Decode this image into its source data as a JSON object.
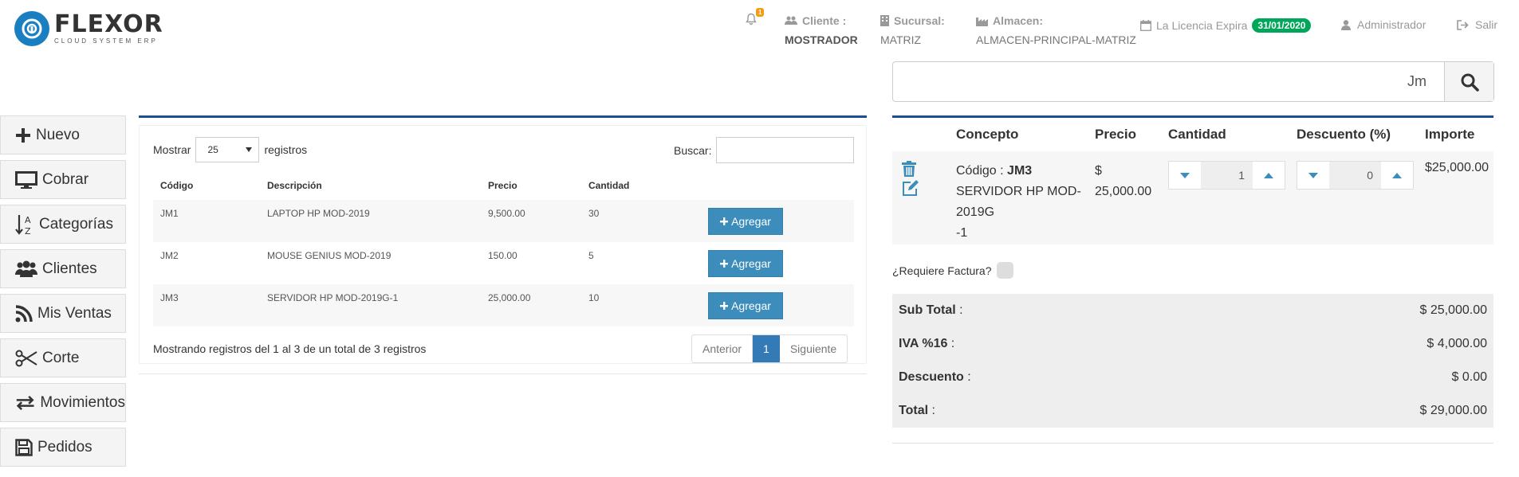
{
  "header": {
    "logo_name": "FLEXOR",
    "logo_tagline": "CLOUD SYSTEM ERP",
    "notification_count": "1",
    "cliente_label": "Cliente :",
    "cliente_value": "MOSTRADOR",
    "sucursal_label": "Sucursal:",
    "sucursal_value": "MATRIZ",
    "almacen_label": "Almacen:",
    "almacen_value": "ALMACEN-PRINCIPAL-MATRIZ",
    "license_label": "La Licencia Expira",
    "license_date": "31/01/2020",
    "user_label": "Administrador",
    "logout_label": "Salir"
  },
  "sidebar": {
    "items": [
      {
        "label": "Nuevo",
        "icon": "plus-icon"
      },
      {
        "label": "Cobrar",
        "icon": "monitor-icon"
      },
      {
        "label": "Categorías",
        "icon": "sort-alpha-icon"
      },
      {
        "label": "Clientes",
        "icon": "users-icon"
      },
      {
        "label": "Mis Ventas",
        "icon": "rss-icon"
      },
      {
        "label": "Corte",
        "icon": "scissors-icon"
      },
      {
        "label": "Movimientos",
        "icon": "exchange-icon"
      },
      {
        "label": "Pedidos",
        "icon": "save-icon"
      }
    ]
  },
  "products": {
    "show_label": "Mostrar",
    "show_value": "25",
    "records_label": "registros",
    "search_label": "Buscar:",
    "columns": [
      "Código",
      "Descripción",
      "Precio",
      "Cantidad"
    ],
    "rows": [
      {
        "code": "JM1",
        "desc": "LAPTOP HP MOD-2019",
        "price": "9,500.00",
        "qty": "30",
        "action": "Agregar"
      },
      {
        "code": "JM2",
        "desc": "MOUSE GENIUS MOD-2019",
        "price": "150.00",
        "qty": "5",
        "action": "Agregar"
      },
      {
        "code": "JM3",
        "desc": "SERVIDOR HP MOD-2019G-1",
        "price": "25,000.00",
        "qty": "10",
        "action": "Agregar"
      }
    ],
    "showing_text": "Mostrando registros del 1 al 3 de un total de 3 registros",
    "pager": {
      "prev": "Anterior",
      "current": "1",
      "next": "Siguiente"
    }
  },
  "search": {
    "value": "Jm"
  },
  "cart": {
    "columns": [
      "Concepto",
      "Precio",
      "Cantidad",
      "Descuento (%)",
      "Importe"
    ],
    "item": {
      "code_label": "Código :",
      "code": "JM3",
      "desc_line1": "SERVIDOR HP MOD-",
      "desc_line2": "2019G",
      "desc_line3": "-1",
      "price_symbol": "$",
      "price": "25,000.00",
      "qty": "1",
      "discount": "0",
      "amount": "$25,000.00"
    }
  },
  "invoice_label": "¿Requiere Factura?",
  "totals": {
    "subtotal_label": "Sub Total",
    "subtotal": "$ 25,000.00",
    "iva_label": "IVA %16",
    "iva": "$ 4,000.00",
    "discount_label": "Descuento",
    "discount": "$ 0.00",
    "total_label": "Total",
    "total": "$ 29,000.00",
    "sep": " :"
  },
  "colors": {
    "primary": "#3c8dbc",
    "box_border": "#1a4f95",
    "license_badge": "#00a65a",
    "notify_badge": "#f39c12"
  }
}
